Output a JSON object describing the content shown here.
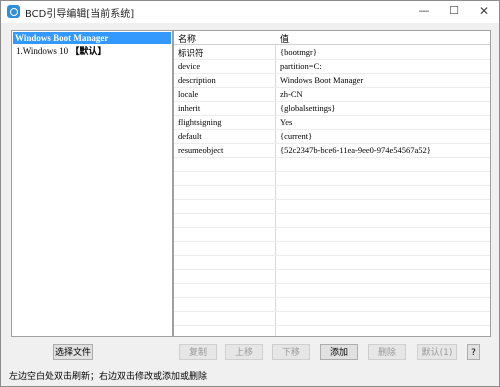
{
  "window": {
    "title": "BCD引导编辑[当前系统]",
    "min_label": "—",
    "max_label": "☐",
    "close_label": "✕"
  },
  "tree": {
    "items": [
      {
        "label": "Windows Boot Manager",
        "selected": true
      },
      {
        "label": "1.Windows 10 ",
        "suffix": "【默认】"
      }
    ]
  },
  "grid": {
    "headers": {
      "name": "名称",
      "value": "值"
    },
    "rows": [
      {
        "name": "标识符",
        "value": "{bootmgr}"
      },
      {
        "name": "device",
        "value": "partition=C:"
      },
      {
        "name": "description",
        "value": "Windows Boot Manager"
      },
      {
        "name": "locale",
        "value": "zh-CN"
      },
      {
        "name": "inherit",
        "value": "{globalsettings}"
      },
      {
        "name": "flightsigning",
        "value": "Yes"
      },
      {
        "name": "default",
        "value": "{current}"
      },
      {
        "name": "resumeobject",
        "value": "{52c2347b-bce6-11ea-9ee0-974e54567a52}"
      }
    ]
  },
  "buttons": {
    "select_file": "选择文件",
    "copy": "复制",
    "up": "上移",
    "down": "下移",
    "add": "添加",
    "delete": "删除",
    "default": "默认(1)",
    "help": "?"
  },
  "status_text": "左边空白处双击刷新；右边双击修改或添加或删除"
}
